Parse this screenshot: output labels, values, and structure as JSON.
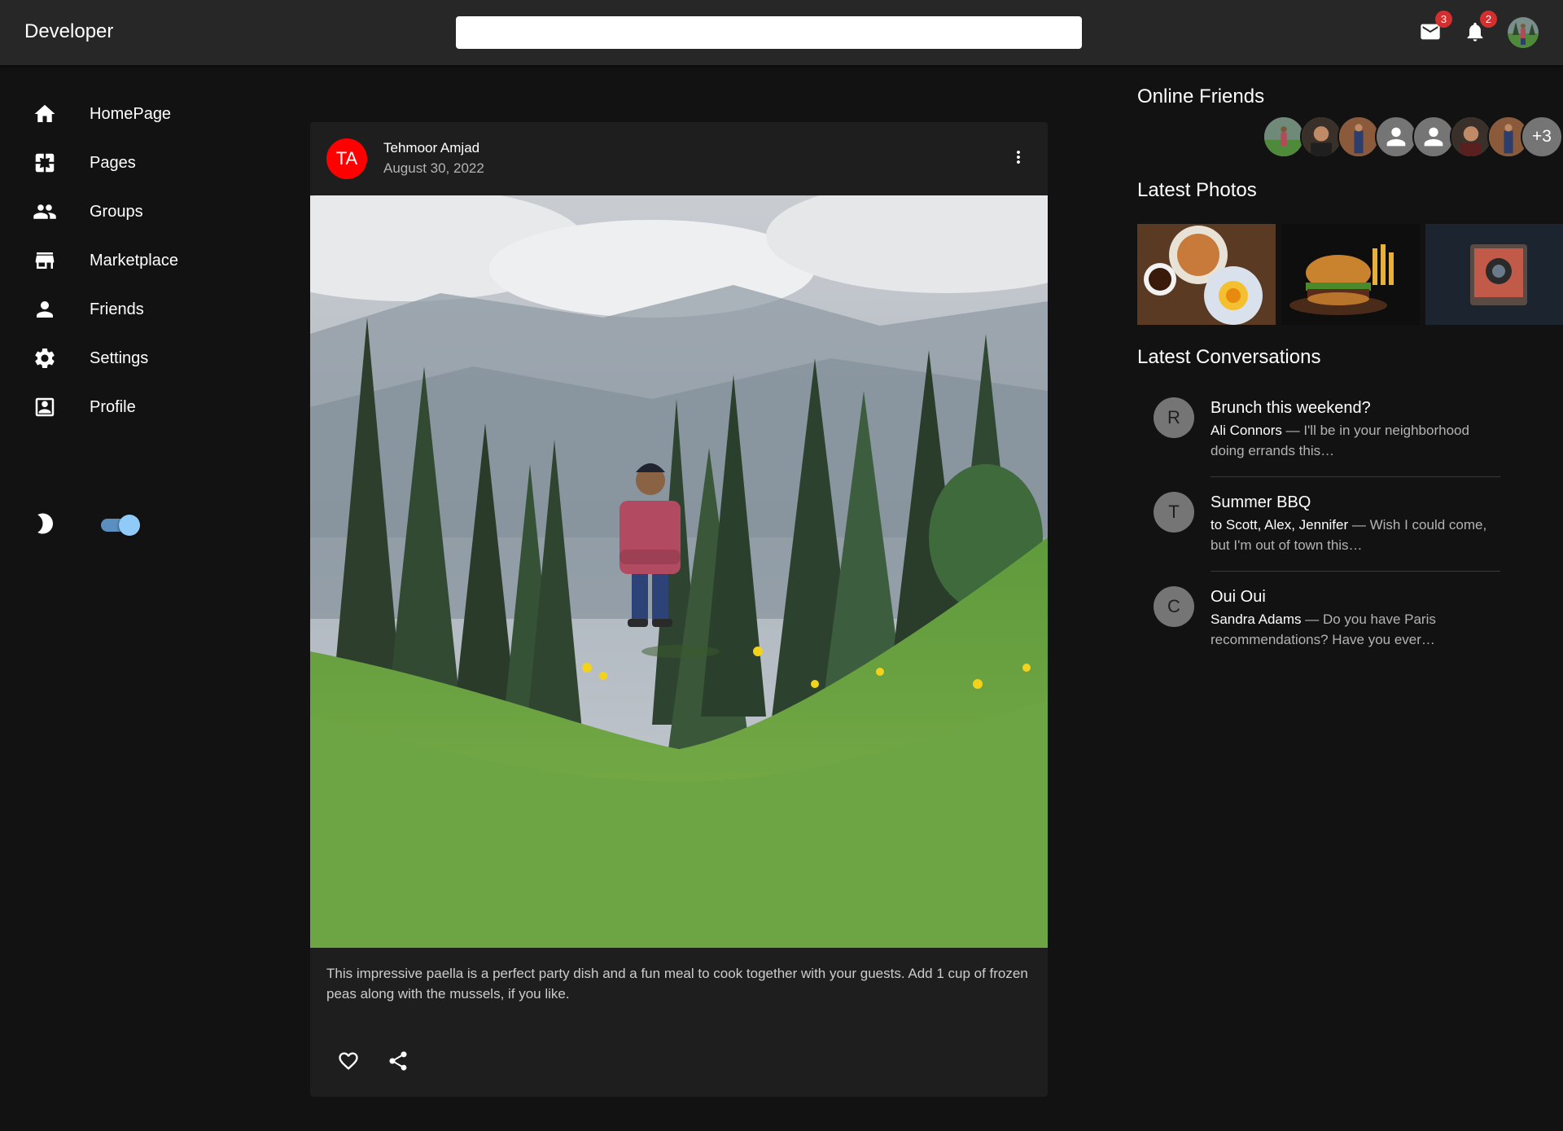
{
  "header": {
    "brand": "Developer",
    "search_placeholder": "",
    "mail_count": "3",
    "notification_count": "2"
  },
  "sidebar": {
    "items": [
      {
        "label": "HomePage",
        "icon": "home-icon"
      },
      {
        "label": "Pages",
        "icon": "pages-icon"
      },
      {
        "label": "Groups",
        "icon": "groups-icon"
      },
      {
        "label": "Marketplace",
        "icon": "storefront-icon"
      },
      {
        "label": "Friends",
        "icon": "person-icon"
      },
      {
        "label": "Settings",
        "icon": "gear-icon"
      },
      {
        "label": "Profile",
        "icon": "account-box-icon"
      }
    ],
    "dark_mode": true
  },
  "post": {
    "avatar_initials": "TA",
    "author": "Tehmoor Amjad",
    "date": "August 30, 2022",
    "text": "This impressive paella is a perfect party dish and a fun meal to cook together with your guests. Add 1 cup of frozen peas along with the mussels, if you like.",
    "avatar_color": "#ff0000"
  },
  "right": {
    "online_friends_title": "Online Friends",
    "online_friends_more": "+3",
    "latest_photos_title": "Latest Photos",
    "latest_conversations_title": "Latest Conversations",
    "conversations": [
      {
        "initial": "R",
        "title": "Brunch this weekend?",
        "from": "Ali Connors",
        "preview": " — I'll be in your neighborhood doing errands this…"
      },
      {
        "initial": "T",
        "title": "Summer BBQ",
        "from": "to Scott, Alex, Jennifer",
        "preview": " — Wish I could come, but I'm out of town this…"
      },
      {
        "initial": "C",
        "title": "Oui Oui",
        "from": "Sandra Adams",
        "preview": " — Do you have Paris recommendations? Have you ever…"
      }
    ]
  },
  "colors": {
    "appbar": "#272727",
    "background": "#121212",
    "card": "#1e1e1e",
    "badge": "#d32f2f",
    "toggle": "#90caf9"
  }
}
